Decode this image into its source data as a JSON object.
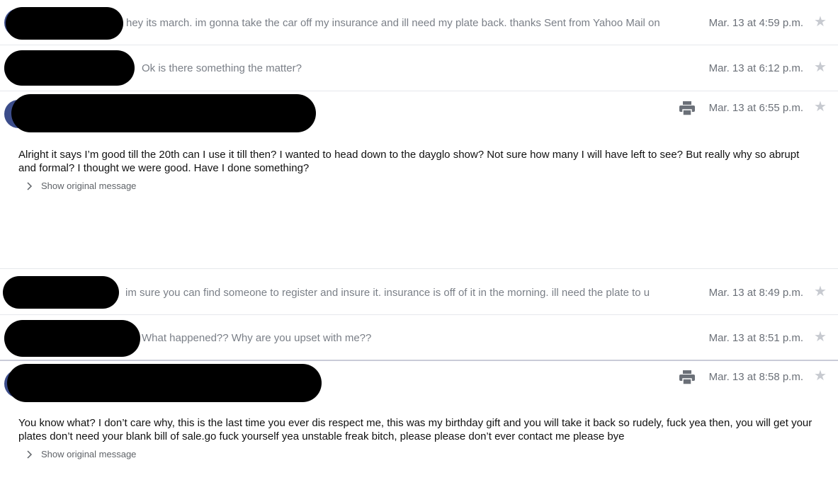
{
  "messages": [
    {
      "type": "collapsed",
      "snippet": "hey its march. im gonna take the car off my insurance and ill need my plate back. thanks Sent from Yahoo Mail on",
      "date": "Mar. 13 at 4:59 p.m."
    },
    {
      "type": "collapsed",
      "snippet": "Ok is there something the matter?",
      "date": "Mar. 13 at 6:12 p.m."
    },
    {
      "type": "expanded",
      "date": "Mar. 13 at 6:55 p.m.",
      "body": "Alright it says I’m good till the 20th can I use it till then? I wanted to head down to the dayglo show? Not sure how many I will have left to see? But really why so abrupt and formal? I thought we were good. Have I done something?",
      "show_original": "Show original message"
    },
    {
      "type": "collapsed",
      "snippet": "im sure you can find someone to register and insure it. insurance is off of it in the morning. ill need the plate to u",
      "date": "Mar. 13 at 8:49 p.m."
    },
    {
      "type": "collapsed",
      "snippet": "What happened?? Why are you upset with me??",
      "date": "Mar. 13 at 8:51 p.m."
    },
    {
      "type": "expanded",
      "date": "Mar. 13 at 8:58 p.m.",
      "body": "You know what? I don’t care why, this is the last time you ever dis respect me, this was my birthday gift and you will take it back so rudely, fuck yea then, you will get your plates don’t need your blank bill of sale.go fuck yourself yea unstable freak bitch, please please don’t ever contact me please bye",
      "show_original": "Show original message"
    }
  ],
  "icons": {
    "star": "star-icon",
    "printer": "printer-icon",
    "chevron": "chevron-right-icon"
  },
  "colors": {
    "avatar": "#3b4c8a",
    "redaction": "#000000",
    "star": "#c7cad0"
  }
}
